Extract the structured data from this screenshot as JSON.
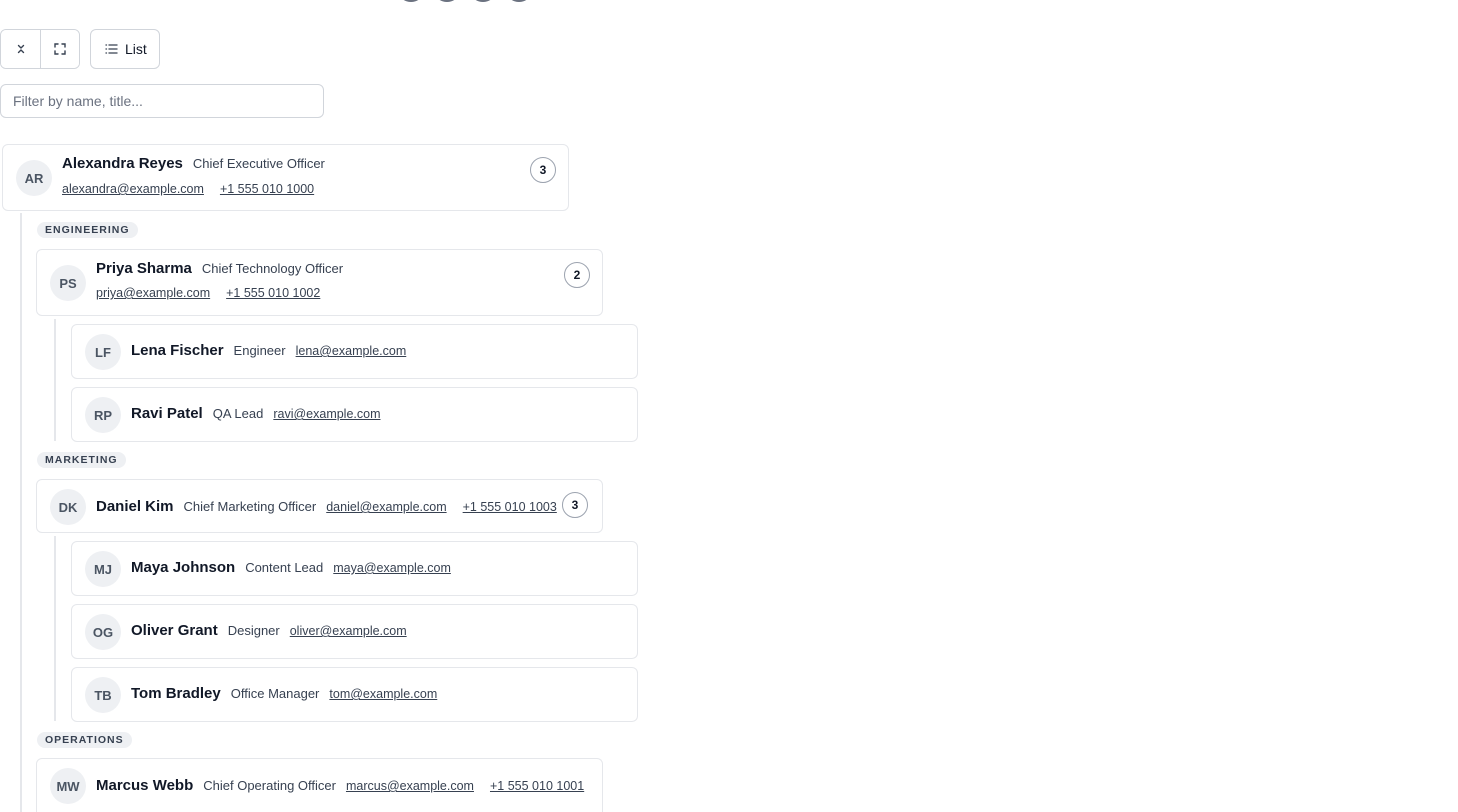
{
  "toolbar": {
    "collapse_icon": "collapse-icon",
    "fullscreen_icon": "fullscreen-icon",
    "list_icon": "list-icon",
    "list_label": "List"
  },
  "filter": {
    "placeholder": "Filter by name, title..."
  },
  "root": {
    "initials": "AR",
    "name": "Alexandra Reyes",
    "title": "Chief Executive Officer",
    "email": "alexandra@example.com",
    "phone": "+1 555 010 1000",
    "reports": "3"
  },
  "departments": [
    {
      "label": "ENGINEERING",
      "head": {
        "initials": "PS",
        "name": "Priya Sharma",
        "title": "Chief Technology Officer",
        "email": "priya@example.com",
        "phone": "+1 555 010 1002",
        "reports": "2"
      },
      "members": [
        {
          "initials": "LF",
          "name": "Lena Fischer",
          "title": "Engineer",
          "email": "lena@example.com"
        },
        {
          "initials": "RP",
          "name": "Ravi Patel",
          "title": "QA Lead",
          "email": "ravi@example.com"
        }
      ]
    },
    {
      "label": "MARKETING",
      "head": {
        "initials": "DK",
        "name": "Daniel Kim",
        "title": "Chief Marketing Officer",
        "email": "daniel@example.com",
        "phone": "+1 555 010 1003",
        "reports": "3"
      },
      "members": [
        {
          "initials": "MJ",
          "name": "Maya Johnson",
          "title": "Content Lead",
          "email": "maya@example.com"
        },
        {
          "initials": "OG",
          "name": "Oliver Grant",
          "title": "Designer",
          "email": "oliver@example.com"
        },
        {
          "initials": "TB",
          "name": "Tom Bradley",
          "title": "Office Manager",
          "email": "tom@example.com"
        }
      ]
    },
    {
      "label": "OPERATIONS",
      "head": {
        "initials": "MW",
        "name": "Marcus Webb",
        "title": "Chief Operating Officer",
        "email": "marcus@example.com",
        "phone": "+1 555 010 1001"
      }
    }
  ]
}
